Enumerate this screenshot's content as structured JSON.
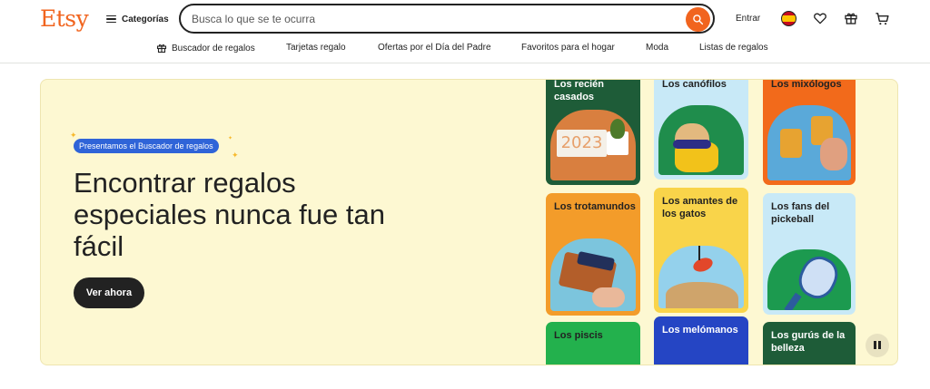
{
  "header": {
    "logo": "Etsy",
    "categories_label": "Categorías",
    "search_placeholder": "Busca lo que se te ocurra",
    "signin_label": "Entrar"
  },
  "subnav": {
    "items": [
      {
        "label": "Buscador de regalos",
        "icon": "gift-icon"
      },
      {
        "label": "Tarjetas regalo"
      },
      {
        "label": "Ofertas por el Día del Padre"
      },
      {
        "label": "Favoritos para el hogar"
      },
      {
        "label": "Moda"
      },
      {
        "label": "Listas de regalos"
      }
    ]
  },
  "hero": {
    "badge": "Presentamos el Buscador de regalos",
    "headline": "Encontrar regalos especiales nunca fue tan fácil",
    "cta": "Ver ahora",
    "cards": [
      {
        "label": "Los recién casados",
        "color": "#1e5c38"
      },
      {
        "label": "Los trotamundos",
        "color": "#f39c2a"
      },
      {
        "label": "Los piscis",
        "color": "#23b14d"
      },
      {
        "label": "Los canófilos",
        "color": "#c8e9f7"
      },
      {
        "label": "Los amantes de los gatos",
        "color": "#f9d44a"
      },
      {
        "label": "Los melómanos",
        "color": "#2545c4"
      },
      {
        "label": "Los mixólogos",
        "color": "#f26a1b"
      },
      {
        "label": "Los fans del pickeball",
        "color": "#c8e9f7"
      },
      {
        "label": "Los gurús de la belleza",
        "color": "#1e5c38"
      }
    ],
    "card_image_text": "2023"
  },
  "colors": {
    "brand": "#f1641e",
    "hero_bg": "#fdf8d2",
    "badge": "#2f64d8"
  }
}
